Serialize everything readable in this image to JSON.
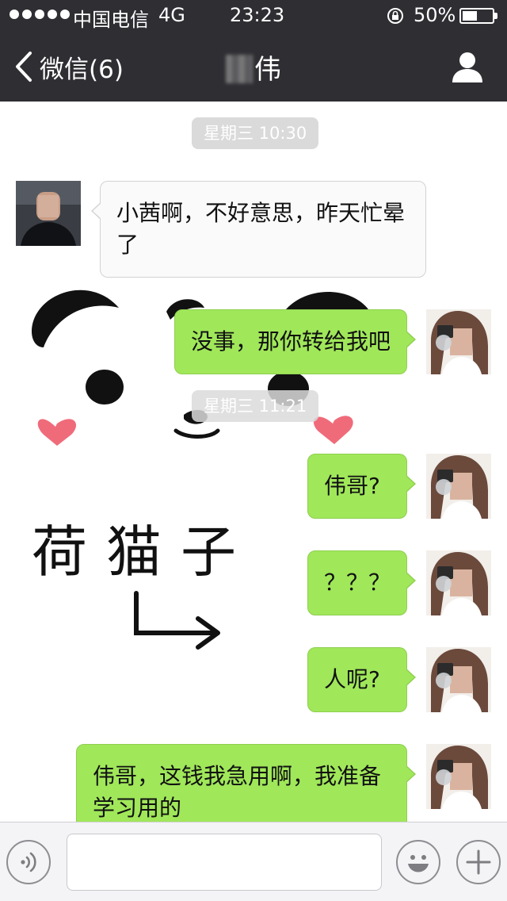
{
  "status_bar": {
    "carrier": "中国电信",
    "network": "4G",
    "time": "23:23",
    "battery_percent": "50%",
    "battery_level": 0.5
  },
  "nav": {
    "back_label": "微信(6)",
    "title": "伟"
  },
  "messages": [
    {
      "type": "timestamp",
      "text": "星期三 10:30"
    },
    {
      "type": "received",
      "text": "小茜啊，不好意思，昨天忙晕了"
    },
    {
      "type": "sent",
      "text": "没事，那你转给我吧"
    },
    {
      "type": "timestamp",
      "text": "星期三 11:21"
    },
    {
      "type": "sent",
      "text": "伟哥?"
    },
    {
      "type": "sent",
      "text": "？？？"
    },
    {
      "type": "sent",
      "text": "人呢?"
    },
    {
      "type": "sent",
      "text": "伟哥，这钱我急用啊，我准备学习用的"
    }
  ],
  "sticker": {
    "caption": "荷猫子",
    "description_icon": "panda-sticker"
  },
  "input_bar": {
    "placeholder": "",
    "voice_icon": "voice-icon",
    "emoji_icon": "emoji-icon",
    "add_icon": "plus-icon"
  },
  "colors": {
    "bar": "#2e2e33",
    "sent_bubble": "#a0e75a",
    "received_bubble": "#fafafa",
    "timestamp_bg": "#dadada"
  }
}
